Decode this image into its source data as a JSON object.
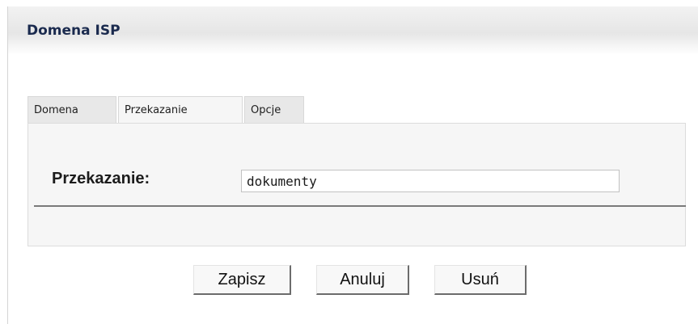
{
  "panel": {
    "title": "Domena ISP"
  },
  "tabs": [
    {
      "label": "Domena",
      "active": false
    },
    {
      "label": "Przekazanie",
      "active": true
    },
    {
      "label": "Opcje",
      "active": false
    }
  ],
  "form": {
    "label": "Przekazanie:",
    "value": "dokumenty"
  },
  "buttons": {
    "save_label": "Zapisz",
    "cancel_label": "Anuluj",
    "delete_label": "Usuń"
  }
}
